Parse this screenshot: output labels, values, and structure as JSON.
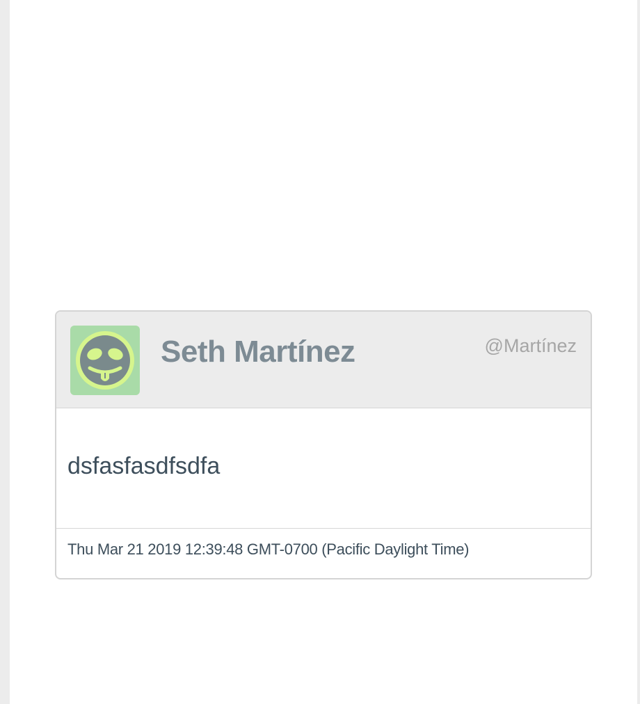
{
  "tweet": {
    "display_name": "Seth Martínez",
    "handle": "@Martínez",
    "text": "dsfasfasdfsdfa",
    "timestamp": "Thu Mar 21 2019 12:39:48 GMT-0700 (Pacific Daylight Time)",
    "avatar_icon": "tongue-out-face-icon"
  },
  "colors": {
    "page_background": "#ececec",
    "card_header_background": "#ececec",
    "avatar_background": "#a9dba8",
    "avatar_face_ring": "#d6f58d",
    "avatar_face": "#7a8a8c",
    "name_color": "#7d8b94",
    "handle_color": "#a6a6a6",
    "body_text_color": "#3d4e5b"
  }
}
